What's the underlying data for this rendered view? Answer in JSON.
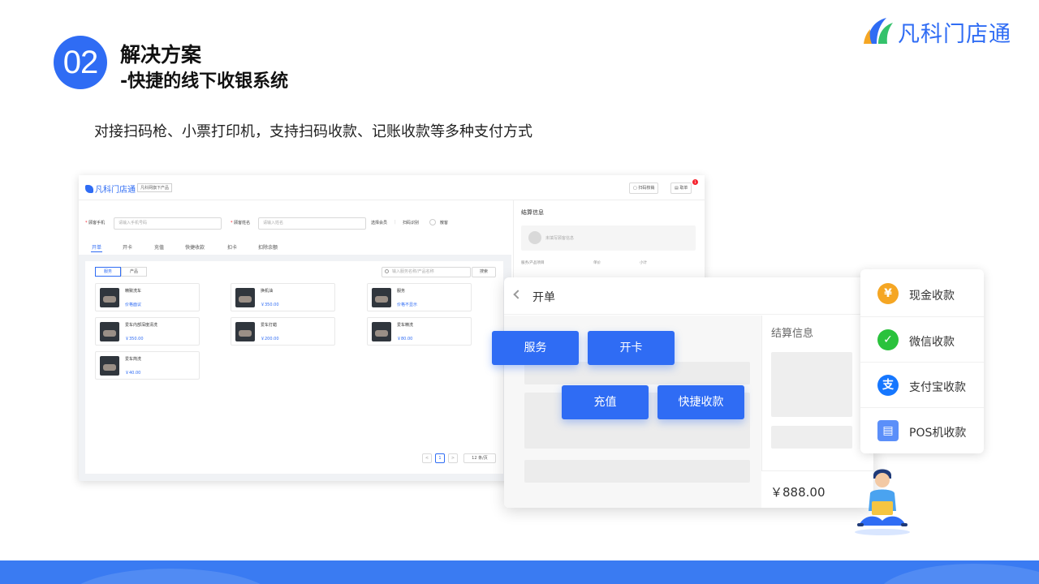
{
  "slide": {
    "number": "02",
    "title_line1": "解决方案",
    "title_line2": "-快捷的线下收银系统",
    "subtitle": "对接扫码枪、小票打印机，支持扫码收款、记账收款等多种支付方式",
    "brand": "凡科门店通"
  },
  "app": {
    "logo": "凡科门店通",
    "tag": "凡科网旗下产品",
    "buttons": {
      "scan": "扫码核销",
      "orders": "取单"
    },
    "badge_count": "1",
    "filters": {
      "phone_label": "顾客手机",
      "phone_placeholder": "请输入手机号码",
      "name_label": "顾客姓名",
      "name_placeholder": "请输入姓名",
      "member_label": "选择会员",
      "scan_label": "扫码识别",
      "guest_label": "散客"
    },
    "tabs": [
      "开单",
      "开卡",
      "充值",
      "快捷收款",
      "扣卡",
      "扣除余额"
    ],
    "segments": [
      "服务",
      "产品"
    ],
    "search_placeholder": "输入服务名称/产品名称",
    "search_button": "搜索",
    "products": [
      {
        "name": "精致洗车",
        "price": "价格面议"
      },
      {
        "name": "换机油",
        "price": "￥350.00"
      },
      {
        "name": "服务",
        "price": "价格不显示"
      },
      {
        "name": "爱车内部深度清洗",
        "price": "￥350.00"
      },
      {
        "name": "爱车打蜡",
        "price": "￥200.00"
      },
      {
        "name": "爱车精洗",
        "price": "￥80.00"
      },
      {
        "name": "爱车简洗",
        "price": "￥40.00"
      }
    ],
    "pager": {
      "prev": "<",
      "page": "1",
      "next": ">",
      "size": "12 条/页"
    },
    "side": {
      "title": "结算信息",
      "member_hint": "未填写顾客信息",
      "col_item": "服务/产品项目",
      "col_price": "单价",
      "col_subtotal": "小计"
    }
  },
  "overlay": {
    "title": "开单",
    "settlement": "结算信息",
    "amount": "￥888.00",
    "buttons": [
      "服务",
      "开卡",
      "充值",
      "快捷收款"
    ]
  },
  "payments": [
    {
      "label": "现金收款",
      "icon": "yen-icon",
      "color": "#f5a623",
      "glyph": "¥"
    },
    {
      "label": "微信收款",
      "icon": "wechat-icon",
      "color": "#2ac23c",
      "glyph": "✓"
    },
    {
      "label": "支付宝收款",
      "icon": "alipay-icon",
      "color": "#1677ff",
      "glyph": "支"
    },
    {
      "label": "POS机收款",
      "icon": "pos-icon",
      "color": "#5b8ff9",
      "glyph": "▤"
    }
  ]
}
